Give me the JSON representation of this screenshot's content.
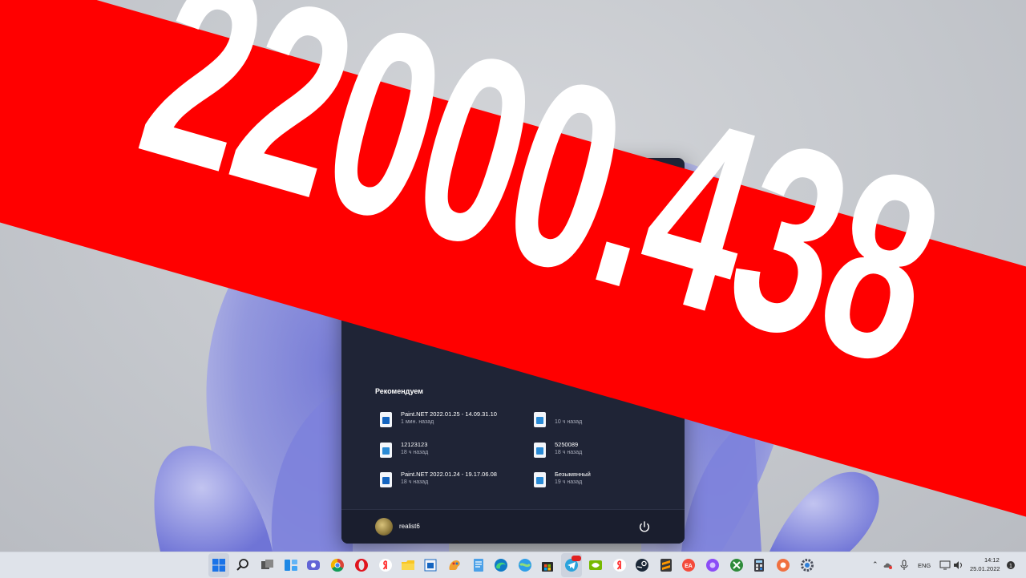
{
  "banner": {
    "text": "22000.438"
  },
  "start_menu": {
    "recommended_title": "Рекомендуем",
    "recommended": [
      {
        "name": "Paint.NET 2022.01.25 - 14.09.31.10",
        "time": "1 мин. назад",
        "icon": "paint-file-icon"
      },
      {
        "name": "",
        "time": "10 ч назад",
        "icon": "image-file-icon"
      },
      {
        "name": "12123123",
        "time": "18 ч назад",
        "icon": "image-file-icon"
      },
      {
        "name": "5250089",
        "time": "18 ч назад",
        "icon": "image-file-icon"
      },
      {
        "name": "Paint.NET 2022.01.24 - 19.17.06.08",
        "time": "18 ч назад",
        "icon": "paint-file-icon"
      },
      {
        "name": "Безымянный",
        "time": "19 ч назад",
        "icon": "image-file-icon"
      }
    ],
    "user": {
      "name": "realist6"
    }
  },
  "taskbar": {
    "apps": [
      "start-icon",
      "search-icon",
      "task-view-icon",
      "widgets-icon",
      "chat-icon",
      "chrome-icon",
      "opera-icon",
      "yandex-icon",
      "file-explorer-icon",
      "paint-net-icon",
      "paint-icon",
      "notepad-icon",
      "edge-icon",
      "maps-icon",
      "store-icon",
      "telegram-icon",
      "nvidia-icon",
      "yandex-browser-icon",
      "steam-icon",
      "sublime-icon",
      "ea-icon",
      "alice-icon",
      "xbox-icon",
      "calculator-icon",
      "record-icon",
      "settings-icon"
    ],
    "telegram_badge": "33",
    "tray": {
      "language": "ENG",
      "time": "14:12",
      "date": "25.01.2022"
    }
  }
}
